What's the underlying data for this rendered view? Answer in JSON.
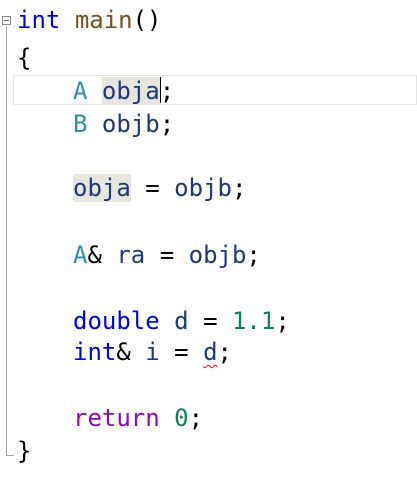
{
  "code": {
    "line1": {
      "kw": "int",
      "fn": "main",
      "punct": "()"
    },
    "line2": {
      "brace": "{"
    },
    "line3": {
      "type": "A",
      "var": "obja",
      "punct": ";"
    },
    "line4": {
      "type": "B",
      "var": "objb",
      "punct": ";"
    },
    "line6": {
      "lhs": "obja",
      "op": "=",
      "rhs": "objb",
      "punct": ";"
    },
    "line8": {
      "type": "A",
      "amp": "&",
      "var": "ra",
      "op": "=",
      "rhs": "objb",
      "punct": ";"
    },
    "line10": {
      "kw": "double",
      "var": "d",
      "op": "=",
      "num": "1.1",
      "punct": ";"
    },
    "line11": {
      "kw": "int",
      "amp": "&",
      "var": "i",
      "op": "=",
      "rhs": "d",
      "punct": ";"
    },
    "line13": {
      "kw": "return",
      "num": "0",
      "punct": ";"
    },
    "line14": {
      "brace": "}"
    }
  },
  "colors": {
    "keyword": "#0000ff",
    "function": "#74531f",
    "type": "#2b91af",
    "variable": "#1f377f",
    "number": "#098658",
    "control": "#8f08c4",
    "reference_highlight": "#e6e6dc",
    "error_squiggle": "#e51400"
  }
}
